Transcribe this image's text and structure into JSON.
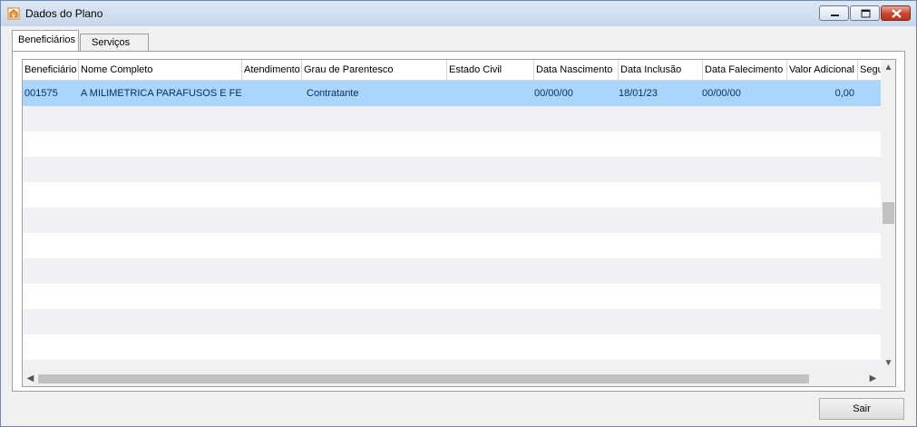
{
  "window": {
    "title": "Dados do Plano"
  },
  "tabs": [
    {
      "label": "Beneficiários",
      "active": true
    },
    {
      "label": "Serviços",
      "active": false
    }
  ],
  "table": {
    "columns": [
      "Beneficiário",
      "Nome Completo",
      "Atendimento",
      "Grau de Parentesco",
      "Estado Civil",
      "Data Nascimento",
      "Data Inclusão",
      "Data Falecimento",
      "Valor Adicional",
      "Segu"
    ],
    "rows": [
      [
        "001575",
        "A MILIMETRICA PARAFUSOS E FERR",
        "",
        "Contratante",
        "",
        "00/00/00",
        "18/01/23",
        "00/00/00",
        "0,00",
        ""
      ]
    ]
  },
  "footer": {
    "close_label": "Sair"
  },
  "colors": {
    "selected_row": "#aad5fd",
    "row_alt": "#f1f1f5",
    "title_gradient_top": "#dbe7f4"
  }
}
